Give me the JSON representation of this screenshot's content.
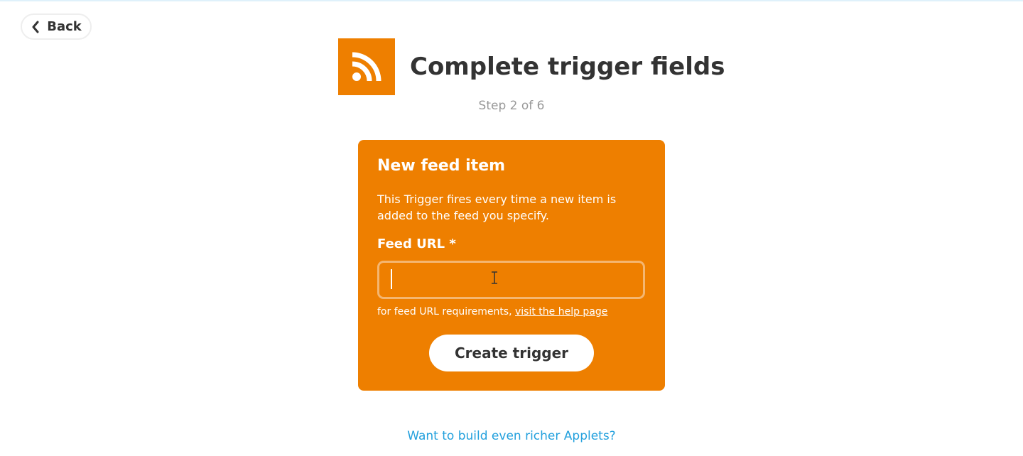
{
  "back_button": {
    "label": "Back",
    "icon": "chevron-left-icon"
  },
  "header": {
    "service_icon": "rss-icon",
    "service_color": "#ee7f00",
    "title": "Complete trigger fields",
    "step": "Step 2 of 6"
  },
  "card": {
    "title": "New feed item",
    "description": "This Trigger fires every time a new item is added to the feed you specify.",
    "field_label": "Feed URL *",
    "field_value": "",
    "help_prefix": "for feed URL requirements, ",
    "help_link": "visit the help page",
    "submit_label": "Create trigger"
  },
  "footer": {
    "link": "Want to build even richer Applets?"
  },
  "colors": {
    "accent": "#ee7f00",
    "link": "#22a0dd",
    "title_text": "#333333",
    "muted_text": "#999999"
  }
}
